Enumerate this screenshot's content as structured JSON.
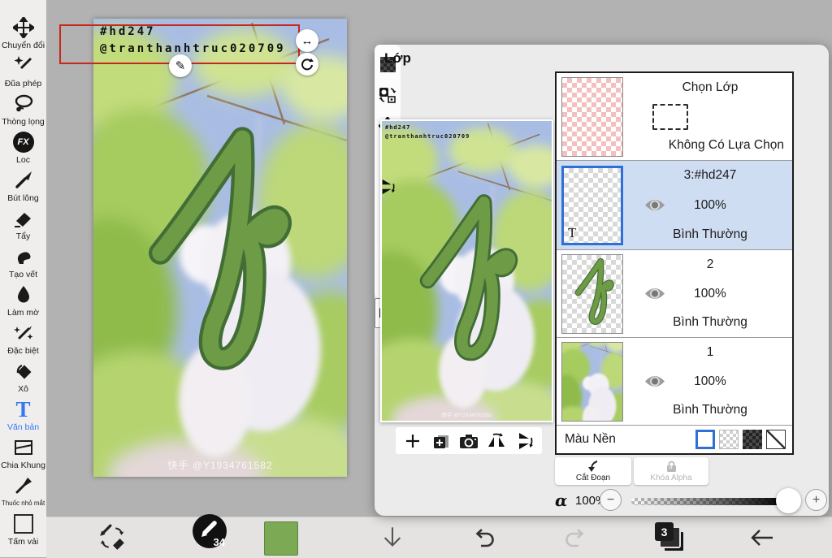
{
  "sidebar": {
    "items": [
      {
        "label": "Chuyển đổi"
      },
      {
        "label": "Đũa phép"
      },
      {
        "label": "Thòng lọng"
      },
      {
        "label": "Loc"
      },
      {
        "label": "Bút lông"
      },
      {
        "label": "Tẩy"
      },
      {
        "label": "Tạo vết"
      },
      {
        "label": "Làm mờ"
      },
      {
        "label": "Đặc biệt"
      },
      {
        "label": "Xô"
      },
      {
        "label": "Văn bản"
      },
      {
        "label": "Chia Khung"
      },
      {
        "label": "Thuốc nhỏ mắt"
      },
      {
        "label": "Tấm vải"
      }
    ]
  },
  "canvas": {
    "hashtag": "#hd247",
    "handle": "@tranthanhtruc020709",
    "watermark": "快手 @Y1934761582"
  },
  "panel": {
    "title": "Lớp",
    "selection": {
      "title": "Chọn Lớp",
      "status": "Không Có Lựa Chọn"
    },
    "layers": [
      {
        "name": "3:#hd247",
        "opacity": "100%",
        "blend": "Bình Thường",
        "thumb_label": "T"
      },
      {
        "name": "2",
        "opacity": "100%",
        "blend": "Bình Thường"
      },
      {
        "name": "1",
        "opacity": "100%",
        "blend": "Bình Thường"
      }
    ],
    "background_label": "Màu Nền",
    "clip_button": "Cắt Đoạn",
    "alpha_lock_button": "Khóa Alpha",
    "alpha_lock_glyph": "α",
    "blend_selected": "Bình Thường",
    "alpha_symbol": "α",
    "alpha_value": "100%"
  },
  "bottom_bar": {
    "brush_size": "34",
    "layer_count": "3"
  },
  "icons": {
    "plus": "+",
    "minus": "−",
    "h_arrow": "↔",
    "pencil": "✎",
    "dots": "⋮",
    "fx": "FX",
    "text_glyph": "T"
  },
  "colors": {
    "accent_blue": "#2e6fd8",
    "tool_active_blue": "#3478f6",
    "letter_green": "#6d9b46",
    "letter_outline": "#426e36",
    "swatch_green": "#7ca953",
    "selection_red": "#c8281c",
    "selected_row_bg": "#cfddf3"
  }
}
